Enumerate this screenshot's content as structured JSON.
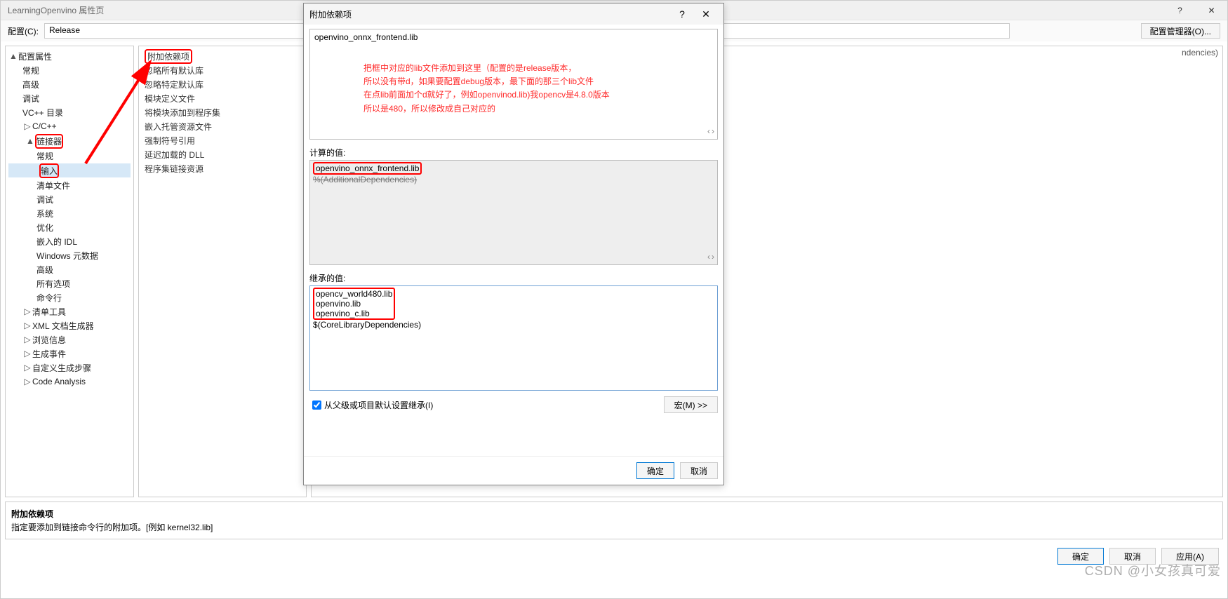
{
  "main_window": {
    "title": "LearningOpenvino 属性页",
    "help_icon": "?",
    "close_icon": "✕",
    "config_label": "配置(C):",
    "config_value": "Release",
    "platform_value": "",
    "manager_button": "配置管理器(O)...",
    "right_tab_suffix": "ndencies)",
    "desc_title": "附加依赖项",
    "desc_text": "指定要添加到链接命令行的附加项。[例如 kernel32.lib]",
    "ok": "确定",
    "cancel": "取消",
    "apply": "应用(A)"
  },
  "tree": {
    "root": "配置属性",
    "items_d1": [
      "常规",
      "高级",
      "调试",
      "VC++ 目录"
    ],
    "cc": "C/C++",
    "linker": "链接器",
    "linker_children": [
      "常规",
      "输入",
      "清单文件",
      "调试",
      "系统",
      "优化",
      "嵌入的 IDL",
      "Windows 元数据",
      "高级",
      "所有选项",
      "命令行"
    ],
    "rest": [
      "清单工具",
      "XML 文档生成器",
      "浏览信息",
      "生成事件",
      "自定义生成步骤",
      "Code Analysis"
    ]
  },
  "mid_panel": {
    "title": "附加依赖项",
    "items": [
      "忽略所有默认库",
      "忽略特定默认库",
      "模块定义文件",
      "将模块添加到程序集",
      "嵌入托管资源文件",
      "强制符号引用",
      "延迟加载的 DLL",
      "程序集链接资源"
    ]
  },
  "dialog": {
    "title": "附加依赖项",
    "editor_value": "openvino_onnx_frontend.lib",
    "annotation_lines": [
      "把框中对应的lib文件添加到这里（配置的是release版本，",
      "所以没有带d，如果要配置debug版本，最下面的那三个lib文件",
      "在点lib前面加个d就好了，例如openvinod.lib)我opencv是4.8.0版本",
      "所以是480，所以修改成自己对应的"
    ],
    "calc_label": "计算的值:",
    "calc_values": [
      "openvino_onnx_frontend.lib",
      "%(AdditionalDependencies)"
    ],
    "inh_label": "继承的值:",
    "inh_values": [
      "opencv_world480.lib",
      "openvino.lib",
      "openvino_c.lib",
      "$(CoreLibraryDependencies)"
    ],
    "inherit_check": "从父级或项目默认设置继承(I)",
    "macro_btn": "宏(M) >>",
    "ok": "确定",
    "cancel": "取消"
  },
  "watermark": "CSDN @小女孩真可爱"
}
